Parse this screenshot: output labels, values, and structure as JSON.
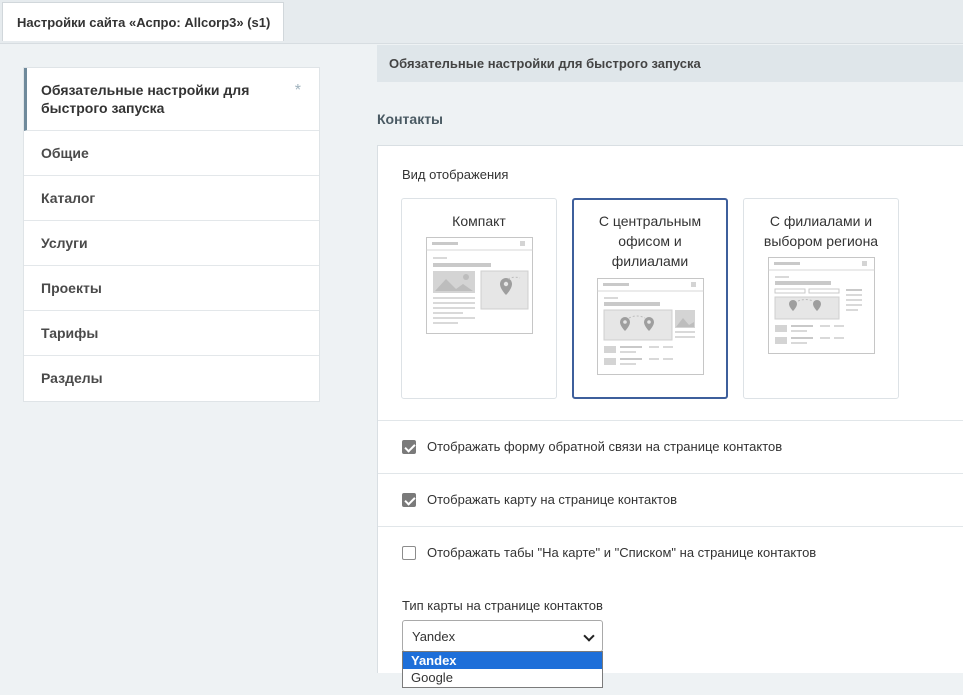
{
  "window": {
    "tab_title": "Настройки сайта «Аспро: Allcorp3» (s1)"
  },
  "sidebar": {
    "items": [
      {
        "label": "Обязательные настройки для быстрого запуска",
        "active": true,
        "star": "*"
      },
      {
        "label": "Общие"
      },
      {
        "label": "Каталог"
      },
      {
        "label": "Услуги"
      },
      {
        "label": "Проекты"
      },
      {
        "label": "Тарифы"
      },
      {
        "label": "Разделы"
      }
    ]
  },
  "main": {
    "header": "Обязательные настройки для быстрого запуска",
    "section_title": "Контакты",
    "view": {
      "label": "Вид отображения",
      "options": [
        {
          "label": "Компакт",
          "selected": false
        },
        {
          "label": "С центральным офисом и филиалами",
          "selected": true
        },
        {
          "label": "С филиалами и выбором региона",
          "selected": false
        }
      ]
    },
    "checkboxes": [
      {
        "label": "Отображать форму обратной связи на странице контактов",
        "checked": true
      },
      {
        "label": "Отображать карту на странице контактов",
        "checked": true
      },
      {
        "label": "Отображать табы \"На карте\" и \"Списком\" на странице контактов",
        "checked": false
      }
    ],
    "map_type": {
      "label": "Тип карты на странице контактов",
      "value": "Yandex",
      "options": [
        "Yandex",
        "Google"
      ]
    }
  },
  "colors": {
    "accent": "#3e5f9c",
    "highlight": "#1e6fd9",
    "header_bg": "#dfe6ea"
  }
}
